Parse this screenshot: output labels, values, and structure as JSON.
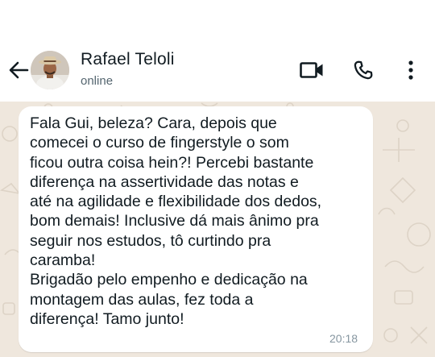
{
  "contact": {
    "name": "Rafael Teloli",
    "status": "online"
  },
  "header_icons": [
    "back-arrow-icon",
    "video-call-icon",
    "phone-call-icon",
    "more-options-icon"
  ],
  "message": {
    "lines": [
      "Fala Gui, beleza? Cara, depois que",
      "comecei o curso de fingerstyle o som",
      "ficou outra coisa hein?! Percebi bastante",
      "diferença na assertividade das notas e",
      "até na agilidade e flexibilidade dos dedos,",
      "bom demais! Inclusive dá mais ânimo pra",
      "seguir nos estudos, tô curtindo pra",
      "caramba!",
      "Brigadão pelo empenho e dedicação na",
      "montagem das aulas, fez toda a",
      "diferença! Tamo junto!"
    ],
    "time": "20:18"
  },
  "colors": {
    "header_bg": "#ffffff",
    "chat_bg": "#efe7dd",
    "bubble_bg": "#ffffff",
    "text": "#111b21",
    "secondary_text": "#54656f",
    "timestamp": "#8696a0"
  }
}
